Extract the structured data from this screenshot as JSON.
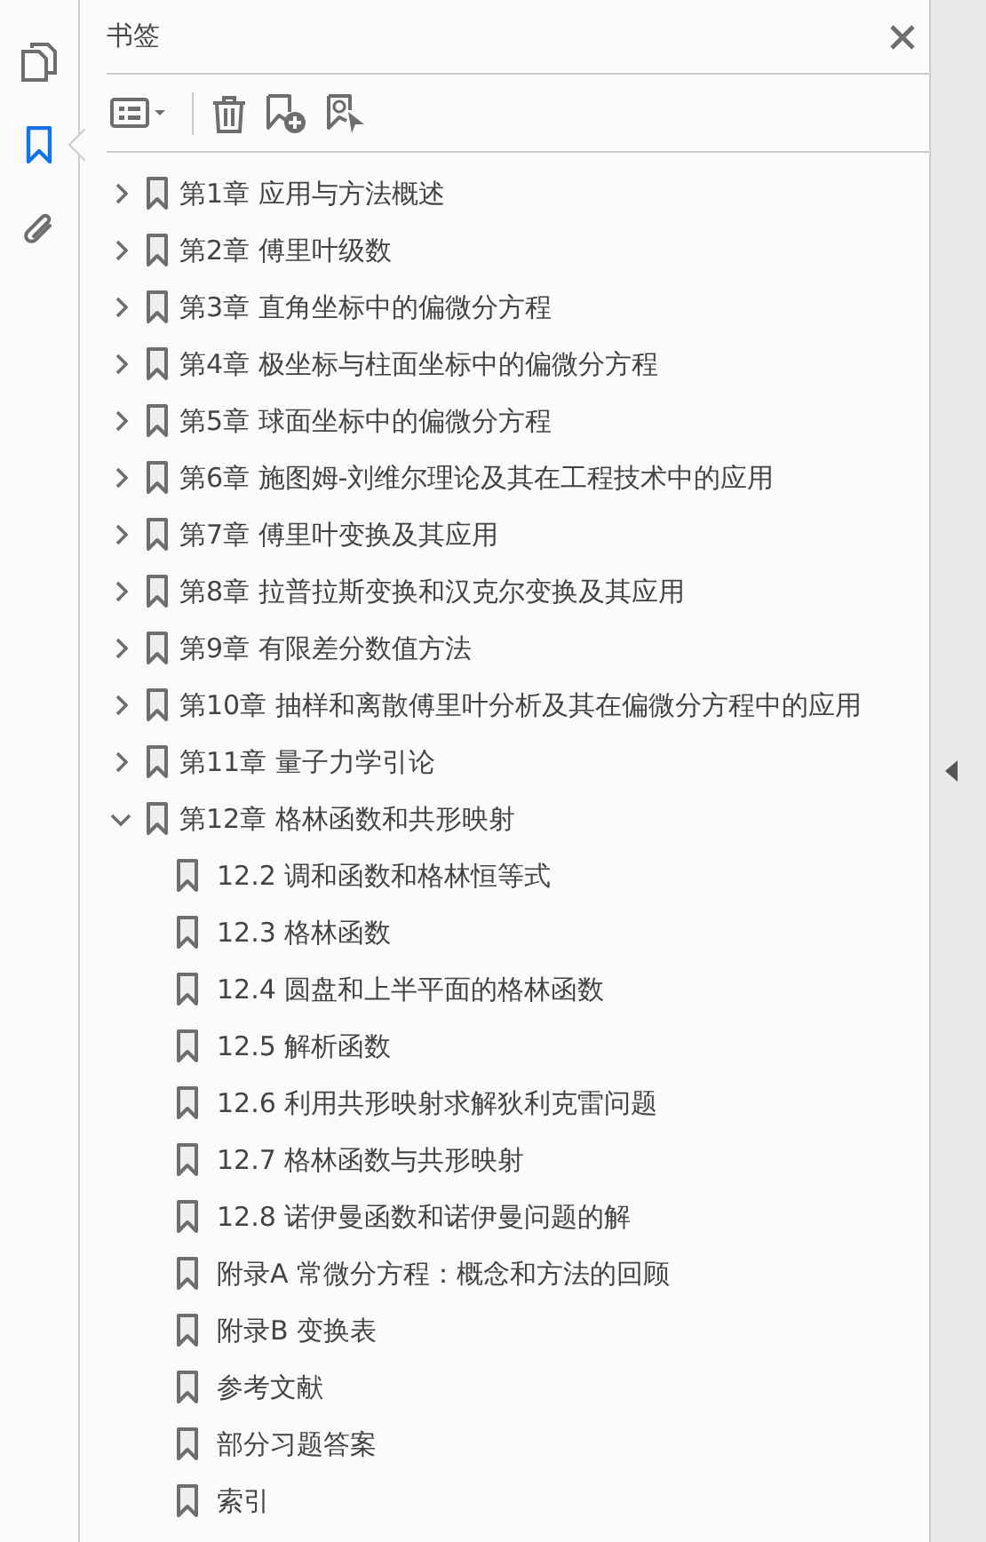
{
  "rail": {
    "tabs": [
      {
        "kind": "pages",
        "selected": false
      },
      {
        "kind": "bookmarks",
        "selected": true
      },
      {
        "kind": "attachments",
        "selected": false
      }
    ]
  },
  "panel": {
    "title": "书签",
    "bookmarks": [
      {
        "label": "第1章 应用与方法概述",
        "expanded": false
      },
      {
        "label": "第2章 傅里叶级数",
        "expanded": false
      },
      {
        "label": "第3章 直角坐标中的偏微分方程",
        "expanded": false
      },
      {
        "label": "第4章 极坐标与柱面坐标中的偏微分方程",
        "expanded": false
      },
      {
        "label": "第5章 球面坐标中的偏微分方程",
        "expanded": false
      },
      {
        "label": "第6章 施图姆-刘维尔理论及其在工程技术中的应用",
        "expanded": false
      },
      {
        "label": "第7章 傅里叶变换及其应用",
        "expanded": false
      },
      {
        "label": "第8章 拉普拉斯变换和汉克尔变换及其应用",
        "expanded": false
      },
      {
        "label": "第9章 有限差分数值方法",
        "expanded": false
      },
      {
        "label": "第10章 抽样和离散傅里叶分析及其在偏微分方程中的应用",
        "expanded": false
      },
      {
        "label": "第11章 量子力学引论",
        "expanded": false
      },
      {
        "label": "第12章 格林函数和共形映射",
        "expanded": true,
        "children": [
          {
            "label": "12.2 调和函数和格林恒等式"
          },
          {
            "label": "12.3 格林函数"
          },
          {
            "label": "12.4 圆盘和上半平面的格林函数"
          },
          {
            "label": "12.5 解析函数"
          },
          {
            "label": "12.6 利用共形映射求解狄利克雷问题"
          },
          {
            "label": "12.7 格林函数与共形映射"
          },
          {
            "label": "12.8 诺伊曼函数和诺伊曼问题的解"
          },
          {
            "label": "附录A  常微分方程：概念和方法的回顾"
          },
          {
            "label": "附录B  变换表"
          },
          {
            "label": "参考文献"
          },
          {
            "label": "部分习题答案"
          },
          {
            "label": "索引"
          }
        ]
      }
    ]
  }
}
